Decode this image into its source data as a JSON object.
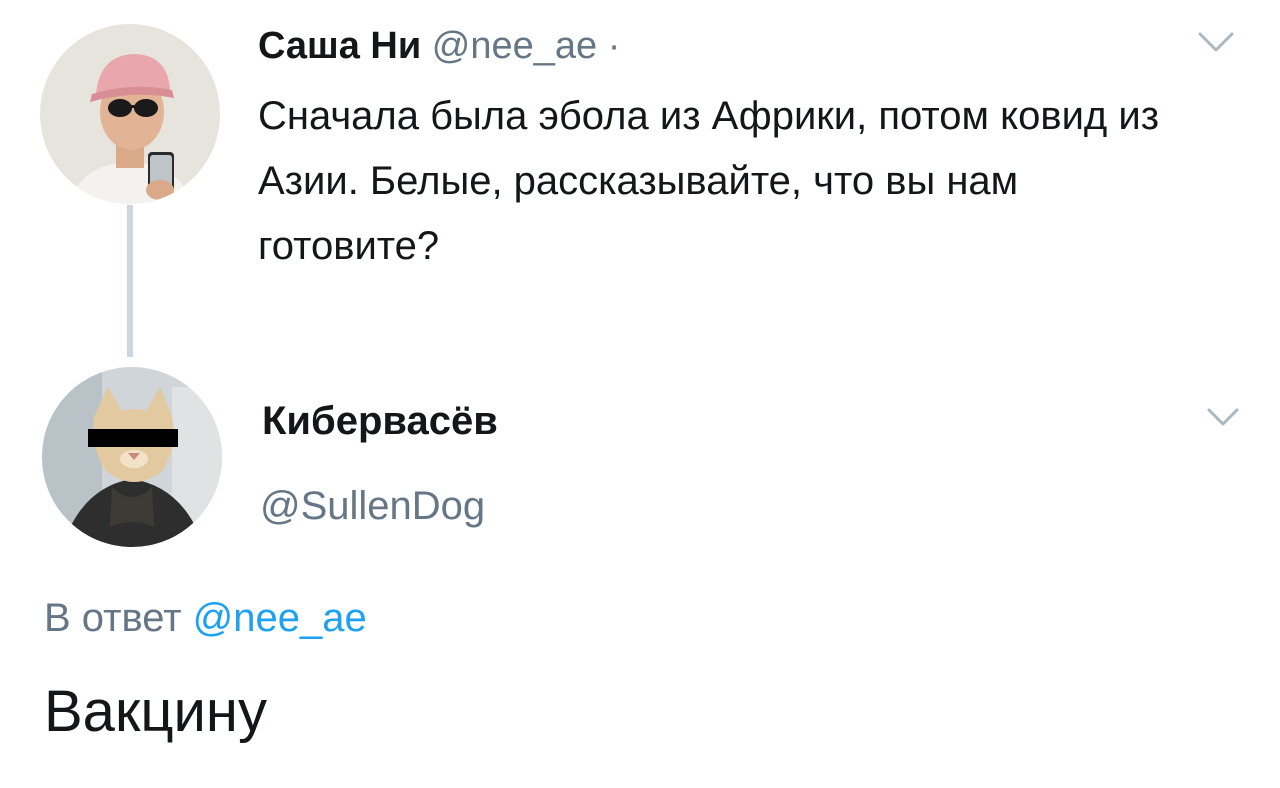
{
  "tweet_original": {
    "author_name": "Саша Ни",
    "author_handle": "@nee_ae",
    "separator": "·",
    "text": "Сначала была эбола из Африки, потом ковид из Азии. Белые, рассказывайте, что вы нам готовите?"
  },
  "tweet_reply": {
    "author_name": "Кибервасёв",
    "author_handle": "@SullenDog",
    "reply_prefix": "В ответ",
    "reply_to_handle": "@nee_ae",
    "text": "Вакцину"
  },
  "colors": {
    "text_primary": "#14171a",
    "text_secondary": "#657786",
    "link": "#1da1f2",
    "thread_line": "#ccd6dd"
  },
  "icons": {
    "menu_caret": "chevron-down-icon"
  }
}
